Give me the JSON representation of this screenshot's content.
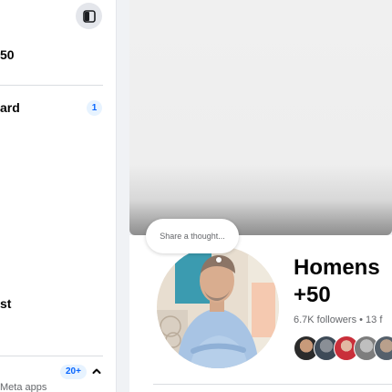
{
  "sidebar": {
    "item_1_label": "50",
    "item_2_label": "ard",
    "item_2_count": "1",
    "item_3_label": "st",
    "more_count": "20+",
    "footer_text": "Meta apps"
  },
  "cover": {
    "bubble_text": "Share a thought..."
  },
  "profile": {
    "name_line1": "Homens",
    "name_line2": "+50",
    "followers": "6.7K followers • 13 f"
  },
  "colors": {
    "accent": "#0866ff",
    "badge_bg": "#e7f3ff",
    "muted_text": "#65676b"
  }
}
